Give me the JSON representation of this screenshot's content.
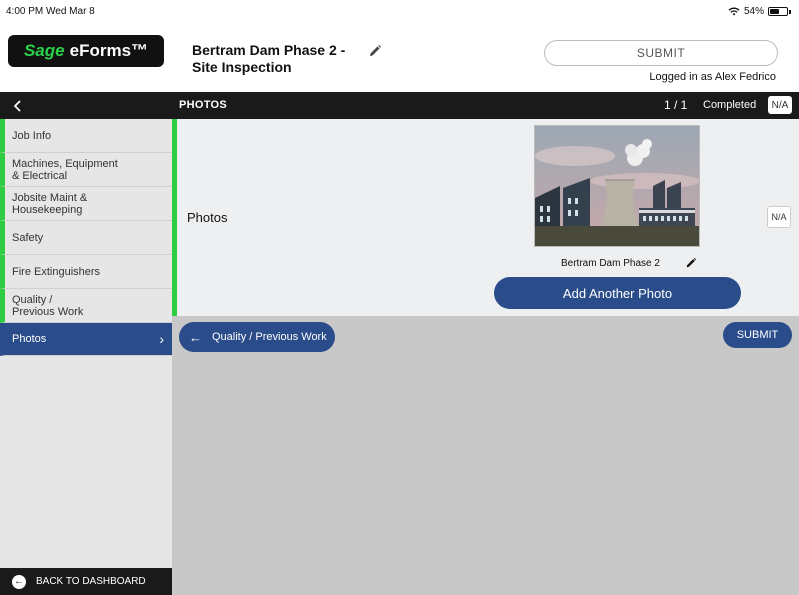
{
  "status_bar": {
    "time": "4:00 PM  Wed Mar 8",
    "battery": "54%",
    "battery_level": 0.54
  },
  "header": {
    "logo_brand": "Sage",
    "logo_product": "eForms™",
    "form_title": "Bertram Dam Phase 2 - Site Inspection",
    "submit_label": "SUBMIT",
    "logged_in": "Logged in as Alex Fedrico"
  },
  "navbar": {
    "section_title": "PHOTOS",
    "page_count": "1 / 1",
    "completed_label": "Completed",
    "na_label": "N/A"
  },
  "sidebar": {
    "items": [
      {
        "label": "Job Info"
      },
      {
        "label": "Machines, Equipment\n& Electrical"
      },
      {
        "label": "Jobsite Maint &\nHousekeeping"
      },
      {
        "label": "Safety"
      },
      {
        "label": "Fire Extinguishers"
      },
      {
        "label": "Quality /\nPrevious Work"
      },
      {
        "label": "Photos"
      }
    ],
    "back_to_dashboard": "BACK TO DASHBOARD"
  },
  "panel": {
    "field_label": "Photos",
    "photo_caption": "Bertram Dam Phase 2",
    "add_photo_label": "Add Another Photo",
    "na_label": "N/A"
  },
  "footer": {
    "prev_label": "Quality / Previous Work",
    "submit_label": "SUBMIT"
  },
  "colors": {
    "accent_green": "#2ecc40",
    "button_blue": "#2a4c8a",
    "navbar_black": "#1a1a1a"
  }
}
